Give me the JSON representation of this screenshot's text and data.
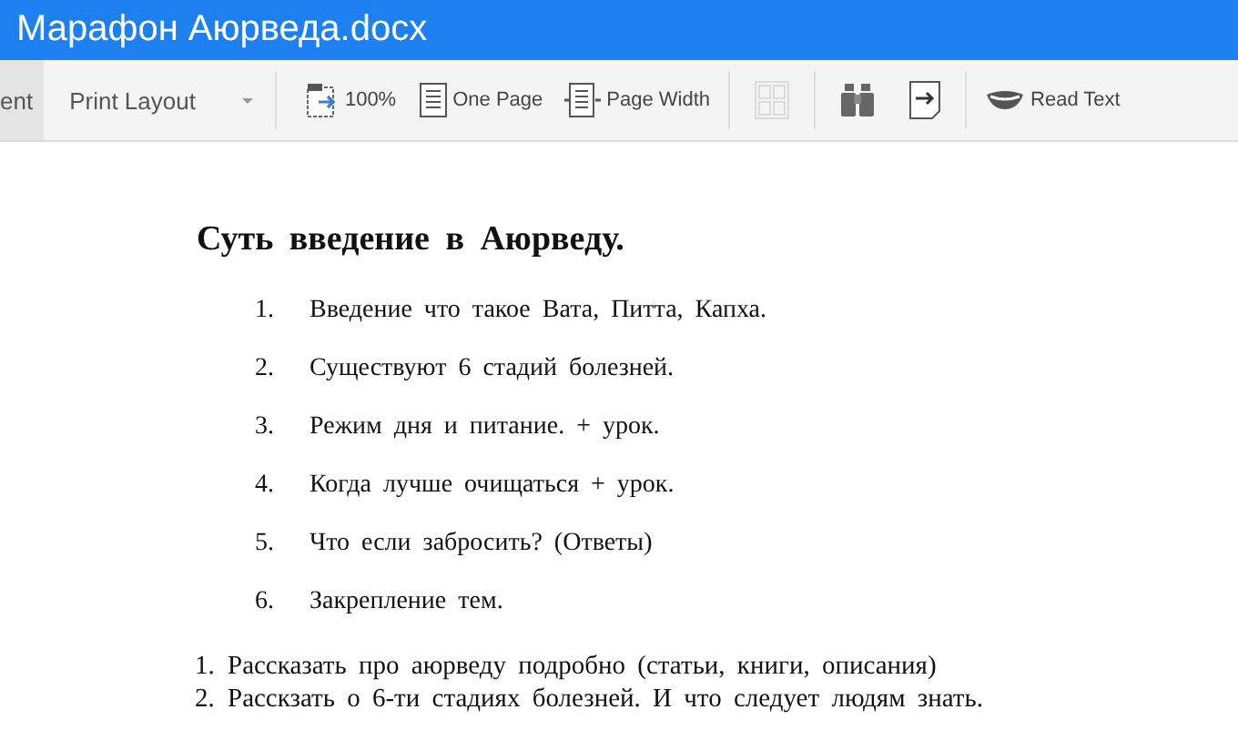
{
  "window": {
    "title": "Марафон Аюрведа.docx"
  },
  "toolbar": {
    "items": [
      {
        "kind": "tab",
        "label": "ent",
        "selected": true
      },
      {
        "kind": "dropdown",
        "label": "Print Layout"
      },
      {
        "kind": "separator"
      },
      {
        "kind": "button",
        "label": "100%"
      },
      {
        "kind": "button",
        "label": "One Page"
      },
      {
        "kind": "button",
        "label": "Page Width"
      },
      {
        "kind": "separator"
      },
      {
        "kind": "icon",
        "disabled": true
      },
      {
        "kind": "separator"
      },
      {
        "kind": "icon",
        "disabled": false
      },
      {
        "kind": "icon",
        "disabled": false
      },
      {
        "kind": "separator"
      },
      {
        "kind": "button",
        "label": "Read Text"
      }
    ]
  },
  "document": {
    "heading": "Суть введение в Аюрведу.",
    "list_1": [
      {
        "number": "1.",
        "text": "Введение что такое Вата, Питта, Капха."
      },
      {
        "number": "2.",
        "text": "Существуют 6 стадий болезней."
      },
      {
        "number": "3.",
        "text": "Режим дня и питание. + урок."
      },
      {
        "number": "4.",
        "text": "Когда лучше очищаться + урок."
      },
      {
        "number": "5.",
        "text": "Что если забросить? (Ответы)"
      },
      {
        "number": "6.",
        "text": "Закрепление тем."
      }
    ],
    "list_2": [
      {
        "number": "1.",
        "text": "Рассказать про аюрведу подробно (статьи, книги, описания)"
      },
      {
        "number": "2.",
        "text": "Расскзать о 6-ти стадиях болезней. И что следует людям знать."
      }
    ]
  }
}
